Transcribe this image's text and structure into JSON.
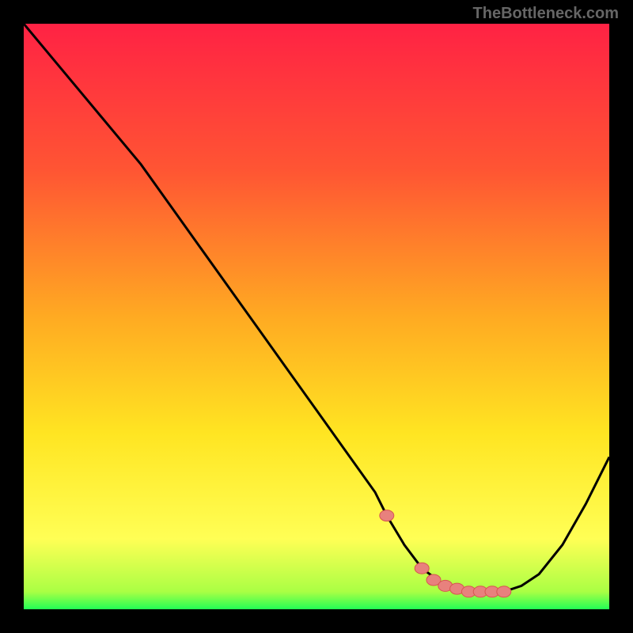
{
  "watermark": "TheBottleneck.com",
  "colors": {
    "background": "#000000",
    "gradient_top": "#ff2244",
    "gradient_mid1": "#ff5533",
    "gradient_mid2": "#ffaa22",
    "gradient_mid3": "#ffe522",
    "gradient_mid4": "#ffff55",
    "gradient_bottom": "#22ff55",
    "curve": "#000000",
    "marker_fill": "#e8817d",
    "marker_stroke": "#d85550"
  },
  "chart_data": {
    "type": "line",
    "title": "",
    "xlabel": "",
    "ylabel": "",
    "xlim": [
      0,
      100
    ],
    "ylim": [
      0,
      100
    ],
    "series": [
      {
        "name": "bottleneck-curve",
        "x": [
          0,
          5,
          10,
          15,
          20,
          25,
          30,
          35,
          40,
          45,
          50,
          55,
          60,
          62,
          65,
          68,
          72,
          76,
          80,
          82,
          85,
          88,
          92,
          96,
          100
        ],
        "values": [
          100,
          94,
          88,
          82,
          76,
          69,
          62,
          55,
          48,
          41,
          34,
          27,
          20,
          16,
          11,
          7,
          4,
          3,
          3,
          3,
          4,
          6,
          11,
          18,
          26
        ]
      }
    ],
    "markers": {
      "name": "highlighted-range",
      "x": [
        62,
        68,
        70,
        72,
        74,
        76,
        78,
        80,
        82
      ],
      "values": [
        16,
        7,
        5,
        4,
        3.5,
        3,
        3,
        3,
        3
      ]
    }
  }
}
